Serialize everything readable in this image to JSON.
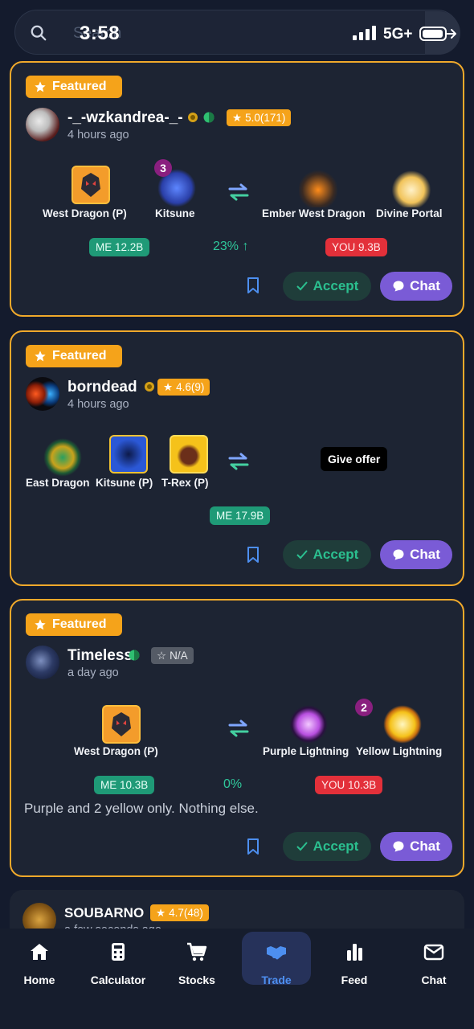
{
  "status_bar": {
    "time": "3:58",
    "network": "5G+"
  },
  "search": {
    "placeholder": "Search"
  },
  "trades": [
    {
      "badge": "Featured",
      "user": "-_-wzkandrea-_-",
      "time_ago": "4 hours ago",
      "rating": "5.0(171)",
      "offer_items": [
        {
          "name": "West Dragon (P)",
          "icon": "west-dragon-icon"
        },
        {
          "name": "Kitsune",
          "icon": "kitsune-icon",
          "qty": "3"
        }
      ],
      "request_items": [
        {
          "name": "Ember West Dragon",
          "icon": "ember-west-dragon-icon"
        },
        {
          "name": "Divine Portal",
          "icon": "divine-portal-icon"
        }
      ],
      "me_value": "ME 12.2B",
      "percent": "23% ↑",
      "you_value": "YOU 9.3B",
      "accept_label": "Accept",
      "chat_label": "Chat"
    },
    {
      "badge": "Featured",
      "user": "borndead",
      "time_ago": "4 hours ago",
      "rating": "4.6(9)",
      "offer_items": [
        {
          "name": "East Dragon",
          "icon": "east-dragon-icon"
        },
        {
          "name": "Kitsune (P)",
          "icon": "kitsune-p-icon"
        },
        {
          "name": "T-Rex (P)",
          "icon": "t-rex-icon"
        }
      ],
      "give_offer_label": "Give offer",
      "me_value": "ME 17.9B",
      "accept_label": "Accept",
      "chat_label": "Chat"
    },
    {
      "badge": "Featured",
      "user": "Timeless",
      "time_ago": "a day ago",
      "rating": "N/A",
      "offer_items": [
        {
          "name": "West Dragon (P)",
          "icon": "west-dragon-icon"
        }
      ],
      "request_items": [
        {
          "name": "Purple Lightning",
          "icon": "purple-lightning-icon"
        },
        {
          "name": "Yellow Lightning",
          "icon": "yellow-lightning-icon",
          "qty": "2"
        }
      ],
      "me_value": "ME 10.3B",
      "percent": "0%",
      "you_value": "YOU 10.3B",
      "note": "Purple and 2 yellow only. Nothing else.",
      "accept_label": "Accept",
      "chat_label": "Chat"
    },
    {
      "user": "SOUBARNO",
      "rating": "4.7(48)",
      "time_ago": "a few seconds ago"
    }
  ],
  "nav": [
    {
      "label": "Home",
      "icon": "home-icon"
    },
    {
      "label": "Calculator",
      "icon": "calculator-icon"
    },
    {
      "label": "Stocks",
      "icon": "cart-icon"
    },
    {
      "label": "Trade",
      "icon": "handshake-icon",
      "active": true
    },
    {
      "label": "Feed",
      "icon": "bar-chart-icon"
    },
    {
      "label": "Chat",
      "icon": "mail-icon"
    }
  ],
  "colors": {
    "featured": "#f5a31a",
    "card_border": "#f0a92b",
    "me": "#1f9a77",
    "you": "#e3303a",
    "chat": "#7a5bd6",
    "accept_text": "#2bbf8f",
    "active_nav": "#4d8ff0"
  }
}
